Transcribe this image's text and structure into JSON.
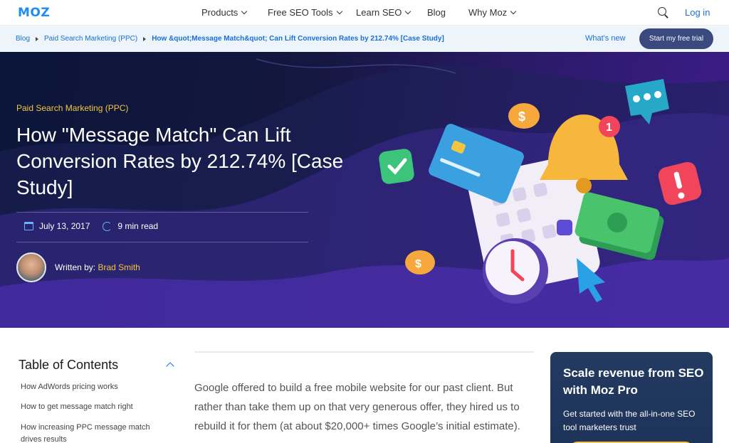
{
  "brand": {
    "logo_text": "MOZ",
    "logo_color": "#1d8cf8",
    "accent": "#1a6fd6"
  },
  "nav": {
    "items": [
      {
        "label": "Products",
        "dropdown": true
      },
      {
        "label": "Free SEO Tools",
        "dropdown": true
      },
      {
        "label": "Learn SEO",
        "dropdown": true
      },
      {
        "label": "Blog",
        "dropdown": false
      },
      {
        "label": "Why Moz",
        "dropdown": true
      }
    ],
    "search_icon": "search-icon",
    "login_label": "Log in"
  },
  "breadcrumb": {
    "items": [
      "Blog",
      "Paid Search Marketing (PPC)",
      "How &quot;Message Match&quot; Can Lift Conversion Rates by 212.74% [Case Study]"
    ]
  },
  "secondary": {
    "whats_new": "What's new",
    "trial_button": "Start my free trial"
  },
  "hero": {
    "category": "Paid Search Marketing (PPC)",
    "title": "How \"Message Match\" Can Lift Conversion Rates by 212.74% [Case Study]",
    "date": "July 13, 2017",
    "read_time": "9 min read",
    "written_by_label": "Written by:",
    "author": "Brad Smith",
    "notification_badge": "1"
  },
  "toc": {
    "title": "Table of Contents",
    "items": [
      "How AdWords pricing works",
      "How to get message match right",
      "How increasing PPC message match drives results"
    ]
  },
  "article": {
    "intro": "Google offered to build a free mobile website for our past client. But rather than take them up on that very generous offer, they hired us to rebuild it for them (at about $20,000+ times Google’s initial estimate)."
  },
  "promo": {
    "title": "Scale revenue from SEO with Moz Pro",
    "subtitle": "Get started with the all-in-one SEO tool marketers trust"
  }
}
